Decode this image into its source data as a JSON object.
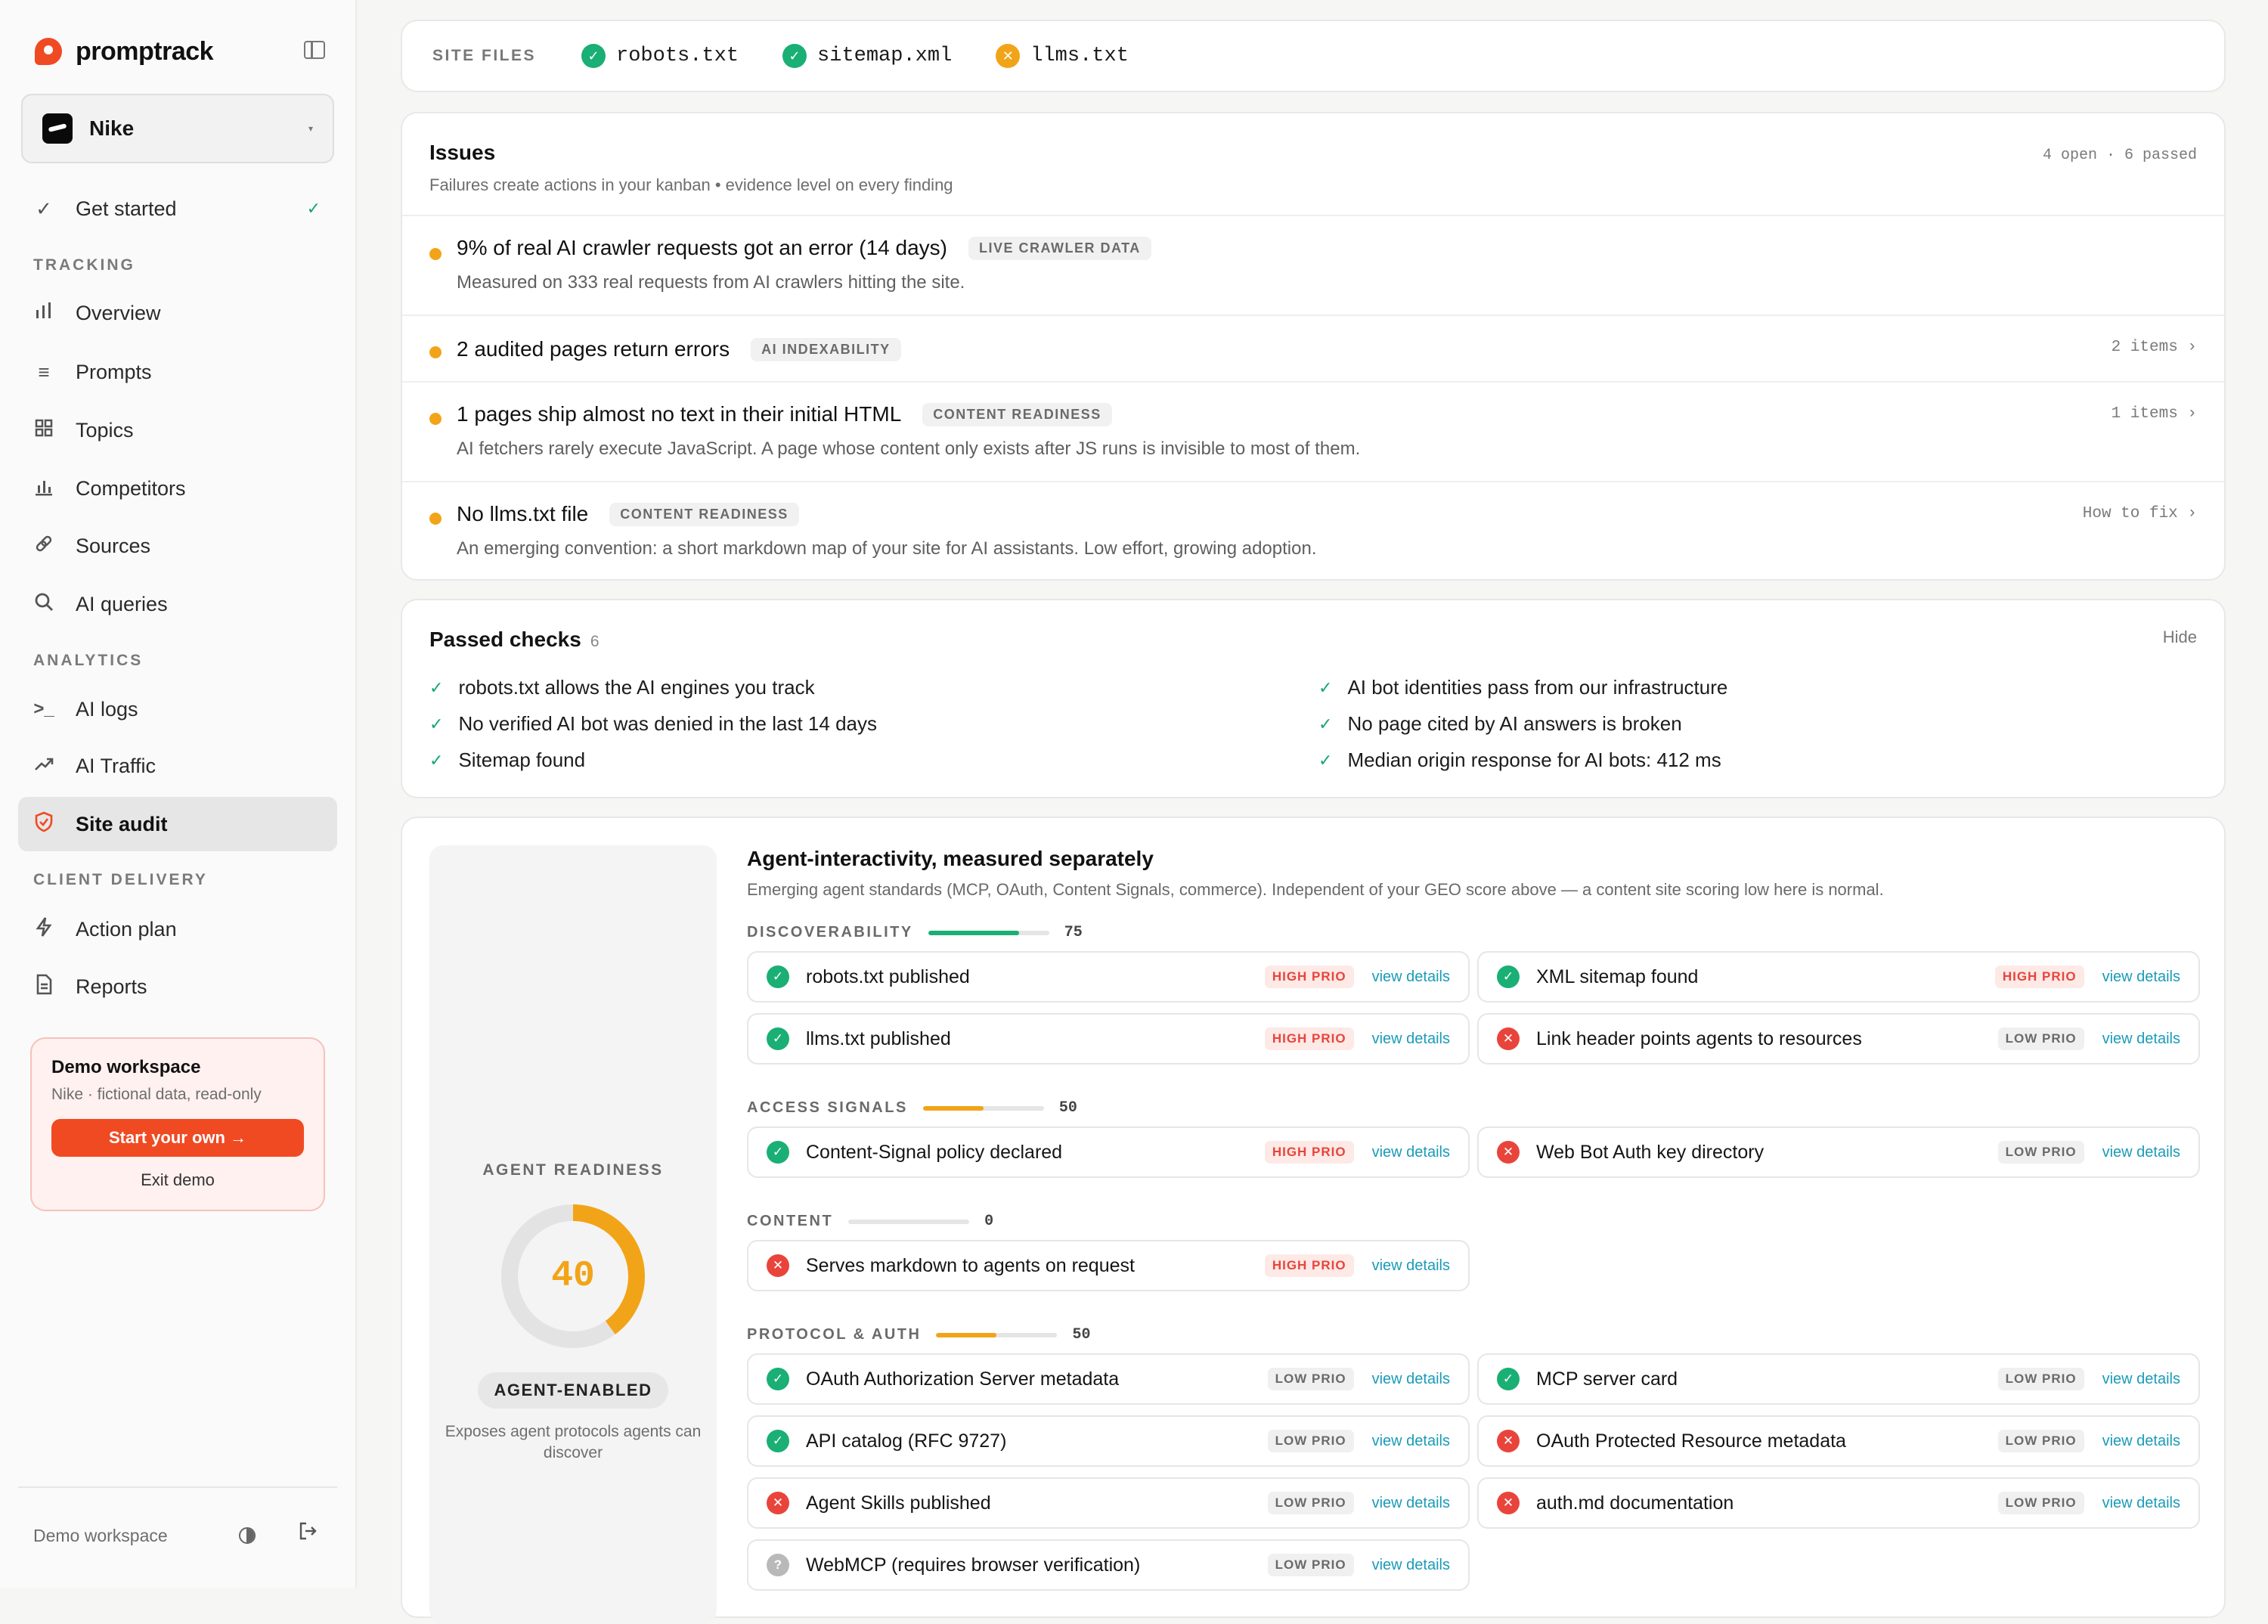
{
  "app": {
    "name": "promptrack"
  },
  "workspace": {
    "name": "Nike"
  },
  "nav": {
    "get_started": "Get started",
    "sections": {
      "tracking": "TRACKING",
      "analytics": "ANALYTICS",
      "client_delivery": "CLIENT DELIVERY"
    },
    "items": {
      "overview": "Overview",
      "prompts": "Prompts",
      "topics": "Topics",
      "competitors": "Competitors",
      "sources": "Sources",
      "ai_queries": "AI queries",
      "ai_logs": "AI logs",
      "ai_traffic": "AI Traffic",
      "site_audit": "Site audit",
      "action_plan": "Action plan",
      "reports": "Reports"
    }
  },
  "demo": {
    "title": "Demo workspace",
    "subtitle": "Nike · fictional data, read-only",
    "start_label": "Start your own →",
    "exit_label": "Exit demo"
  },
  "footer": {
    "label": "Demo workspace"
  },
  "site_files": {
    "label": "SITE FILES",
    "items": [
      {
        "name": "robots.txt",
        "status": "ok"
      },
      {
        "name": "sitemap.xml",
        "status": "ok"
      },
      {
        "name": "llms.txt",
        "status": "warn"
      }
    ]
  },
  "issues": {
    "title": "Issues",
    "subtitle": "Failures create actions in your kanban • evidence level on every finding",
    "meta": "4 open · 6 passed",
    "rows": [
      {
        "title": "9% of real AI crawler requests got an error (14 days)",
        "tag": "LIVE CRAWLER DATA",
        "desc": "Measured on 333 real requests from AI crawlers hitting the site.",
        "link": ""
      },
      {
        "title": "2 audited pages return errors",
        "tag": "AI INDEXABILITY",
        "desc": "",
        "link": "2 items ›"
      },
      {
        "title": "1 pages ship almost no text in their initial HTML",
        "tag": "CONTENT READINESS",
        "desc": "AI fetchers rarely execute JavaScript. A page whose content only exists after JS runs is invisible to most of them.",
        "link": "1 items ›"
      },
      {
        "title": "No llms.txt file",
        "tag": "CONTENT READINESS",
        "desc": "An emerging convention: a short markdown map of your site for AI assistants. Low effort, growing adoption.",
        "link": "How to fix ›"
      }
    ]
  },
  "passed": {
    "title": "Passed checks",
    "count": "6",
    "hide_label": "Hide",
    "items": [
      "robots.txt allows the AI engines you track",
      "No verified AI bot was denied in the last 14 days",
      "Sitemap found",
      "AI bot identities pass from our infrastructure",
      "No page cited by AI answers is broken",
      "Median origin response for AI bots: 412 ms"
    ]
  },
  "agent": {
    "title": "Agent-interactivity, measured separately",
    "subtitle": "Emerging agent standards (MCP, OAuth, Content Signals, commerce). Independent of your GEO score above — a content site scoring low here is normal.",
    "readiness_label": "AGENT READINESS",
    "score": 40,
    "score_text": "40",
    "badge": "AGENT-ENABLED",
    "desc": "Exposes agent protocols agents can discover",
    "view_details": "view details",
    "high_prio": "HIGH PRIO",
    "low_prio": "LOW PRIO",
    "sections": [
      {
        "label": "DISCOVERABILITY",
        "score": 75,
        "score_text": "75",
        "color": "#1aaf74",
        "checks": [
          {
            "name": "robots.txt published",
            "status": "ok",
            "prio": "high"
          },
          {
            "name": "XML sitemap found",
            "status": "ok",
            "prio": "high"
          },
          {
            "name": "llms.txt published",
            "status": "ok",
            "prio": "high"
          },
          {
            "name": "Link header points agents to resources",
            "status": "err",
            "prio": "low"
          }
        ]
      },
      {
        "label": "ACCESS SIGNALS",
        "score": 50,
        "score_text": "50",
        "color": "#f2a418",
        "checks": [
          {
            "name": "Content-Signal policy declared",
            "status": "ok",
            "prio": "high"
          },
          {
            "name": "Web Bot Auth key directory",
            "status": "err",
            "prio": "low"
          }
        ]
      },
      {
        "label": "CONTENT",
        "score": 0,
        "score_text": "0",
        "color": "#e9443b",
        "checks": [
          {
            "name": "Serves markdown to agents on request",
            "status": "err",
            "prio": "high"
          }
        ]
      },
      {
        "label": "PROTOCOL & AUTH",
        "score": 50,
        "score_text": "50",
        "color": "#f2a418",
        "checks": [
          {
            "name": "OAuth Authorization Server metadata",
            "status": "ok",
            "prio": "low"
          },
          {
            "name": "MCP server card",
            "status": "ok",
            "prio": "low"
          },
          {
            "name": "API catalog (RFC 9727)",
            "status": "ok",
            "prio": "low"
          },
          {
            "name": "OAuth Protected Resource metadata",
            "status": "err",
            "prio": "low"
          },
          {
            "name": "Agent Skills published",
            "status": "err",
            "prio": "low"
          },
          {
            "name": "auth.md documentation",
            "status": "err",
            "prio": "low"
          },
          {
            "name": "WebMCP (requires browser verification)",
            "status": "unk",
            "prio": "low"
          }
        ]
      }
    ]
  }
}
